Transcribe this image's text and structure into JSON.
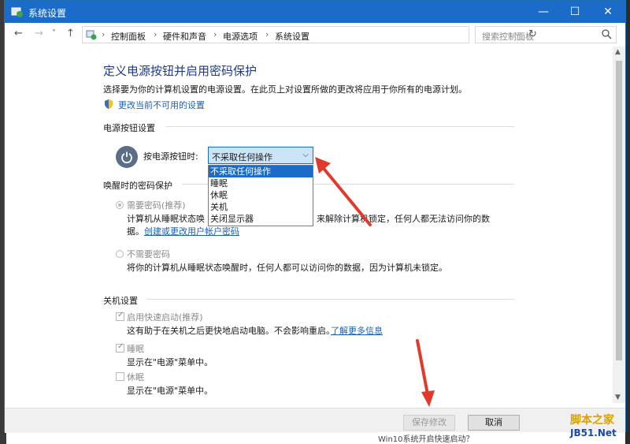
{
  "window": {
    "title": "系统设置",
    "minimize": "—",
    "maximize": "☐",
    "close": "✕"
  },
  "nav": {
    "back": "←",
    "forward": "→",
    "recent": "˅",
    "up": "↑"
  },
  "breadcrumb": [
    "控制面板",
    "硬件和声音",
    "电源选项",
    "系统设置"
  ],
  "search": {
    "placeholder": "搜索控制面板"
  },
  "page": {
    "title": "定义电源按钮并启用密码保护",
    "description": "选择要为你的计算机设置的电源设置。在此页上对设置所做的更改将应用于你所有的电源计划。",
    "change_link": "更改当前不可用的设置"
  },
  "power_section": {
    "heading": "电源按钮设置",
    "label": "按电源按钮时:",
    "selected": "不采取任何操作",
    "options": [
      "不采取任何操作",
      "睡眠",
      "休眠",
      "关机",
      "关闭显示器"
    ]
  },
  "wake_section": {
    "heading": "唤醒时的密码保护",
    "require": {
      "label": "需要密码(推荐)",
      "desc_line1_a": "计算机从睡眠状态唤",
      "desc_line1_b": "来解除计算机锁定，任何人都无法访问你的数",
      "desc_line2_a": "据。",
      "desc_line2_link": "创建或更改用户帐户密码"
    },
    "no_password": {
      "label": "不需要密码",
      "desc": "将你的计算机从睡眠状态唤醒时，任何人都可以访问你的数据，因为计算机未锁定。"
    }
  },
  "shutdown_section": {
    "heading": "关机设置",
    "fast_startup": {
      "label": "启用快速启动(推荐)",
      "checked": true,
      "desc": "这有助于在关机之后更快地启动电脑。不会影响重启。",
      "link": "了解更多信息"
    },
    "sleep": {
      "label": "睡眠",
      "checked": true,
      "desc": "显示在\"电源\"菜单中。"
    },
    "hibernate": {
      "label": "休眠",
      "checked": false,
      "desc": "显示在\"电源\"菜单中。"
    }
  },
  "footer": {
    "save": "保存修改",
    "cancel": "取消"
  },
  "watermark": {
    "line1": "脚本之家",
    "line2": "JB51.Net"
  },
  "background_text": "Win10系统开启快速启动？",
  "colors": {
    "titlebar": "#1a6cc8",
    "link": "#1a5fb4",
    "arrow": "#e03a2f"
  }
}
